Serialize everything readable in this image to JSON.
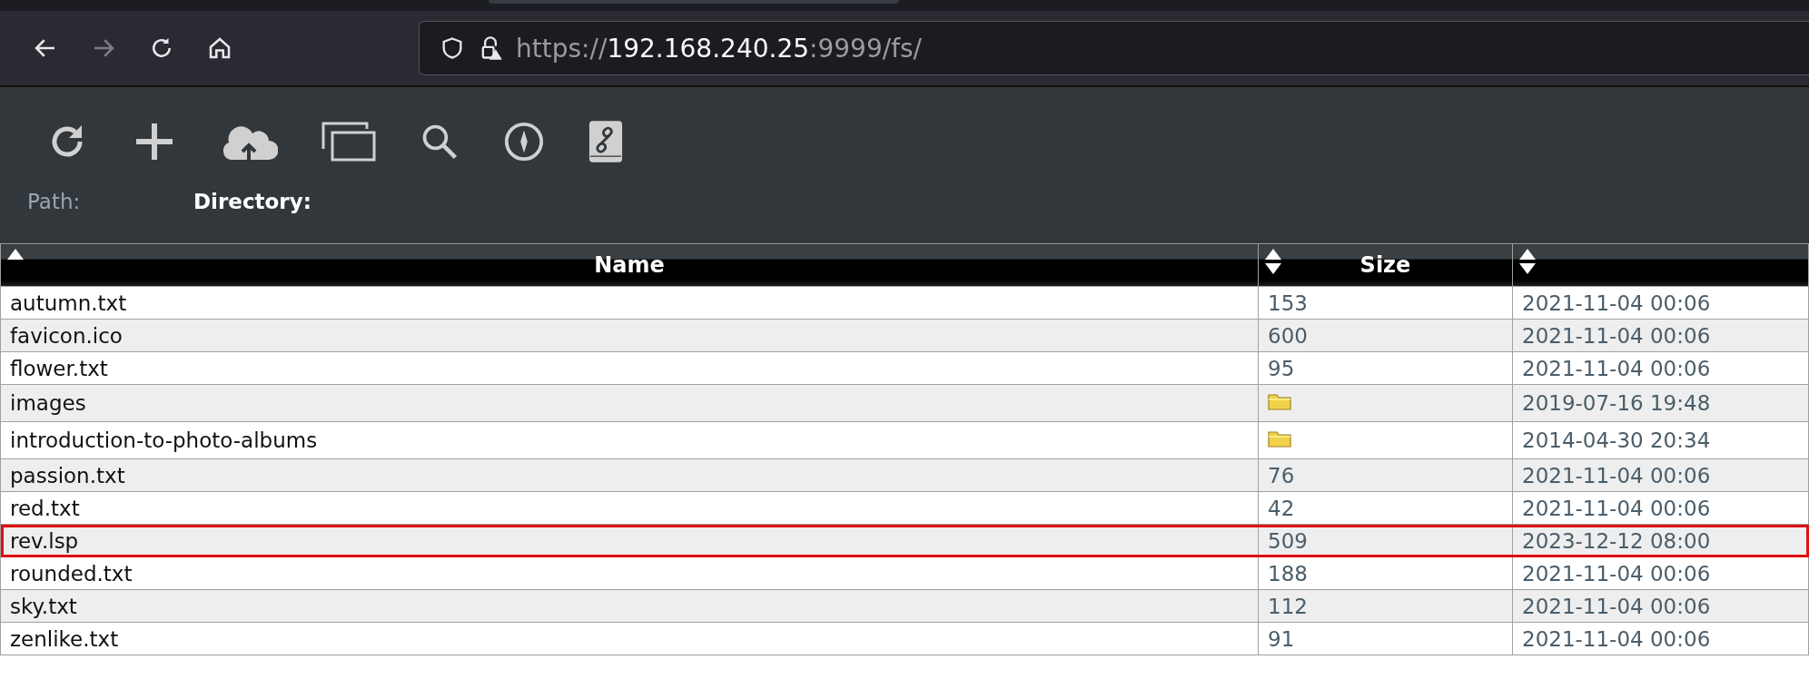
{
  "browser": {
    "url_scheme": "https://",
    "url_host": "192.168.240.25",
    "url_rest": ":9999/fs/"
  },
  "toolbar": {
    "path_label": "Path:",
    "directory_label": "Directory:"
  },
  "table": {
    "columns": [
      {
        "label": "Name",
        "sorted": true
      },
      {
        "label": "Size",
        "sorted": false
      },
      {
        "sorted": false
      }
    ],
    "rows": [
      {
        "name": "autumn.txt",
        "kind": "file",
        "size": "153",
        "date": "2021-11-04 00:06",
        "highlighted": false
      },
      {
        "name": "favicon.ico",
        "kind": "file",
        "size": "600",
        "date": "2021-11-04 00:06",
        "highlighted": false
      },
      {
        "name": "flower.txt",
        "kind": "file",
        "size": "95",
        "date": "2021-11-04 00:06",
        "highlighted": false
      },
      {
        "name": "images",
        "kind": "folder",
        "date": "2019-07-16 19:48",
        "highlighted": false
      },
      {
        "name": "introduction-to-photo-albums",
        "kind": "folder",
        "date": "2014-04-30 20:34",
        "highlighted": false
      },
      {
        "name": "passion.txt",
        "kind": "file",
        "size": "76",
        "date": "2021-11-04 00:06",
        "highlighted": false
      },
      {
        "name": "red.txt",
        "kind": "file",
        "size": "42",
        "date": "2021-11-04 00:06",
        "highlighted": false
      },
      {
        "name": "rev.lsp",
        "kind": "file",
        "size": "509",
        "date": "2023-12-12 08:00",
        "highlighted": true
      },
      {
        "name": "rounded.txt",
        "kind": "file",
        "size": "188",
        "date": "2021-11-04 00:06",
        "highlighted": false
      },
      {
        "name": "sky.txt",
        "kind": "file",
        "size": "112",
        "date": "2021-11-04 00:06",
        "highlighted": false
      },
      {
        "name": "zenlike.txt",
        "kind": "file",
        "size": "91",
        "date": "2021-11-04 00:06",
        "highlighted": false
      }
    ]
  }
}
